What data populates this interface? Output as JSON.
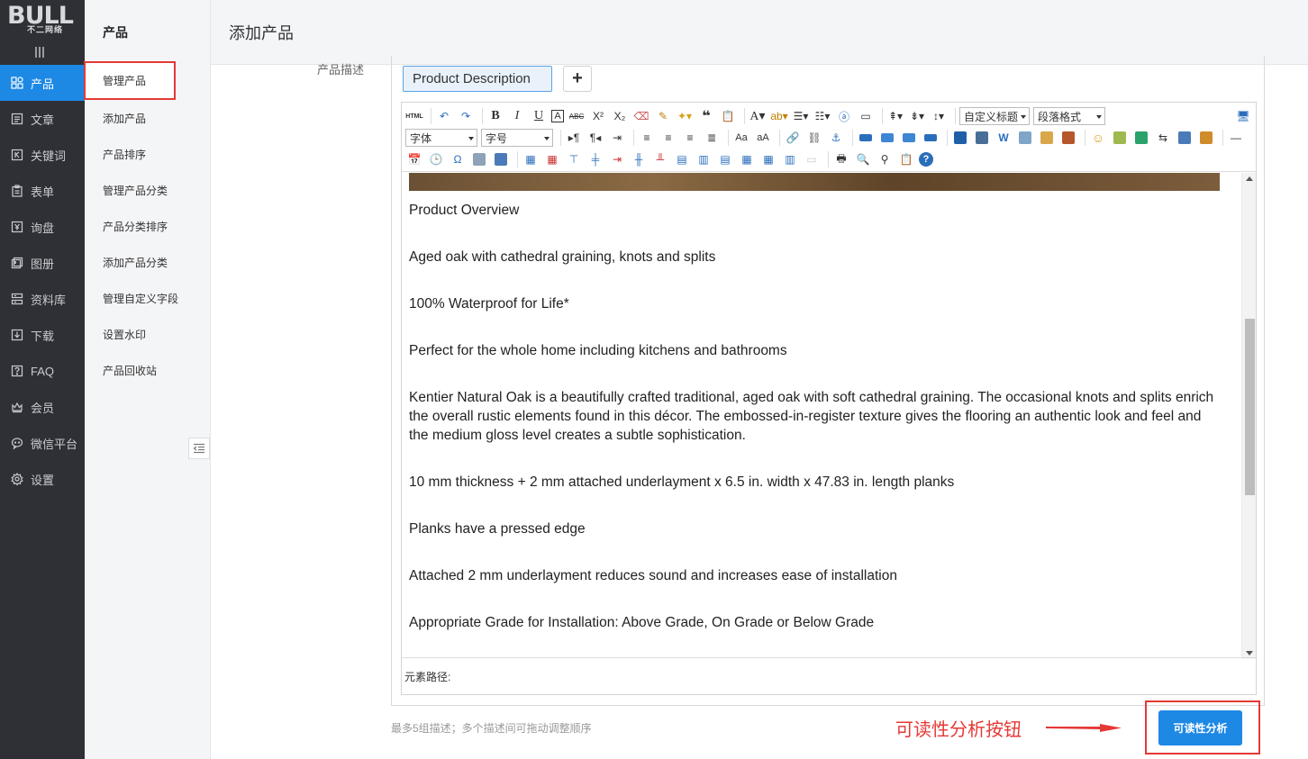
{
  "logo": {
    "main": "BULL",
    "sub": "不二网络"
  },
  "nav": {
    "items": [
      {
        "label": "产品",
        "icon": "grid-icon",
        "active": true
      },
      {
        "label": "文章",
        "icon": "article-icon"
      },
      {
        "label": "关键词",
        "icon": "keyword-icon"
      },
      {
        "label": "表单",
        "icon": "form-icon"
      },
      {
        "label": "询盘",
        "icon": "inquiry-icon"
      },
      {
        "label": "图册",
        "icon": "gallery-icon"
      },
      {
        "label": "资料库",
        "icon": "database-icon"
      },
      {
        "label": "下载",
        "icon": "download-icon"
      },
      {
        "label": "FAQ",
        "icon": "faq-icon"
      },
      {
        "label": "会员",
        "icon": "member-icon"
      },
      {
        "label": "微信平台",
        "icon": "wechat-icon"
      },
      {
        "label": "设置",
        "icon": "settings-icon"
      }
    ]
  },
  "submenu": {
    "title": "产品",
    "items": [
      {
        "label": "管理产品",
        "active": true
      },
      {
        "label": "添加产品"
      },
      {
        "label": "产品排序"
      },
      {
        "label": "管理产品分类"
      },
      {
        "label": "产品分类排序"
      },
      {
        "label": "添加产品分类"
      },
      {
        "label": "管理自定义字段"
      },
      {
        "label": "设置水印"
      },
      {
        "label": "产品回收站"
      }
    ]
  },
  "header": {
    "title": "添加产品"
  },
  "form": {
    "field_label": "产品描述",
    "desc_tab": "Product Description",
    "add_tab": "+",
    "toolbar": {
      "custom_title": "自定义标题",
      "paragraph": "段落格式",
      "font": "字体",
      "size": "字号"
    },
    "paragraphs": [
      "Product Overview",
      "Aged oak with cathedral graining, knots and splits",
      "100% Waterproof for Life*",
      "Perfect for the whole home including kitchens and bathrooms",
      "Kentier Natural Oak is a beautifully crafted traditional, aged oak with soft cathedral graining. The occasional knots and splits enrich the overall rustic elements found in this décor. The embossed-in-register texture gives the flooring an authentic look and feel and the medium gloss level creates a subtle sophistication.",
      "10 mm thickness + 2 mm attached underlayment x 6.5 in. width x 47.83 in. length planks",
      "Planks have a pressed edge",
      "Attached 2 mm underlayment reduces sound and increases ease of installation",
      "Appropriate Grade for Installation: Above Grade, On Grade or Below Grade"
    ],
    "element_path": "元素路径:",
    "hint": "最多5组描述；多个描述间可拖动调整顺序",
    "callout": "可读性分析按钮",
    "analyze_button": "可读性分析"
  },
  "colors": {
    "accent": "#1e88e5",
    "highlight": "#e53935",
    "sidebar": "#2e3035"
  }
}
